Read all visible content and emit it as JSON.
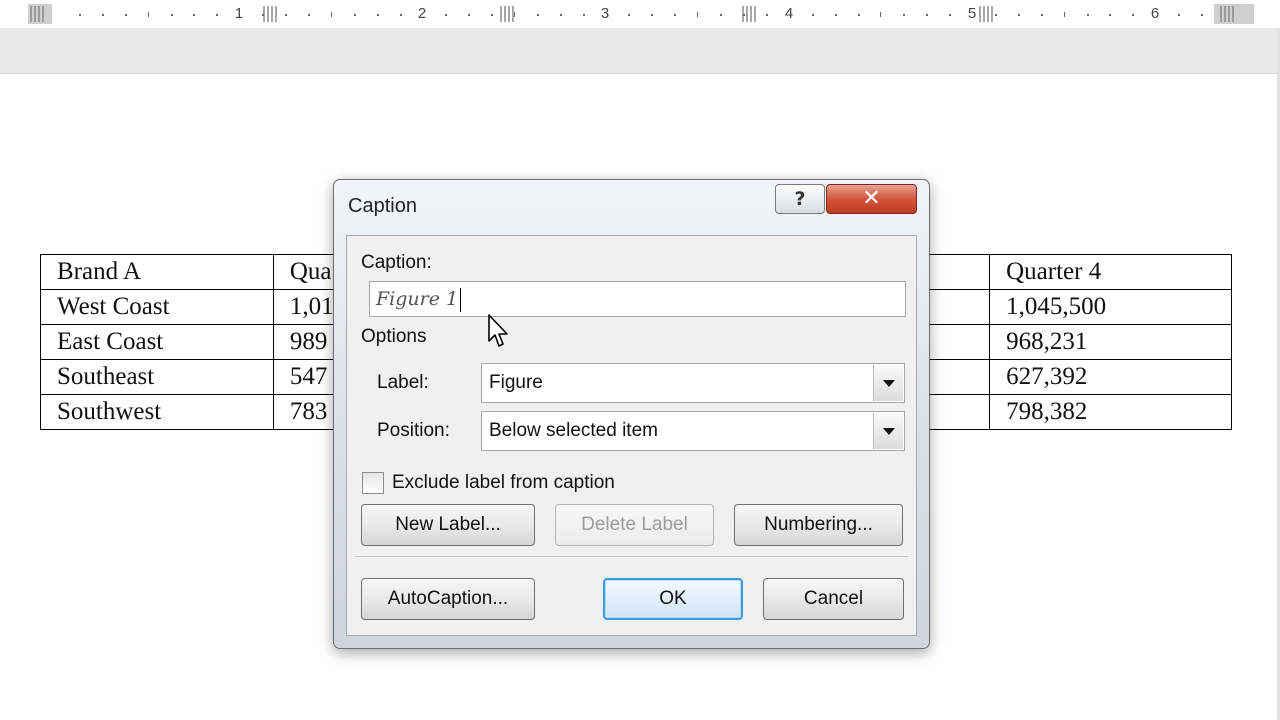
{
  "ruler": {
    "numbers": [
      "1",
      "2",
      "3",
      "4",
      "5",
      "6"
    ]
  },
  "document": {
    "table": {
      "left_columns": [
        [
          "Brand A",
          "Qua"
        ],
        [
          "West Coast",
          "1,01"
        ],
        [
          "East Coast",
          "989"
        ],
        [
          "Southeast",
          "547"
        ],
        [
          "Southwest",
          "783"
        ]
      ],
      "right_column": [
        "Quarter 4",
        "1,045,500",
        "968,231",
        "627,392",
        "798,382"
      ]
    }
  },
  "dialog": {
    "title": "Caption",
    "help_label": "?",
    "close_label": "✕",
    "caption_label": "Caption:",
    "caption_value": "Figure 1",
    "options_label": "Options",
    "label_field_label": "Label:",
    "label_value": "Figure",
    "position_field_label": "Position:",
    "position_value": "Below selected item",
    "exclude_label_text": "Exclude label from caption",
    "exclude_checked": false,
    "new_label_button": "New Label...",
    "delete_label_button": "Delete Label",
    "numbering_button": "Numbering...",
    "autocaption_button": "AutoCaption...",
    "ok_button": "OK",
    "cancel_button": "Cancel"
  },
  "colors": {
    "close_button": "#c94a32",
    "default_button_border": "#3c9be0",
    "dialog_body": "#f0f0f0"
  }
}
